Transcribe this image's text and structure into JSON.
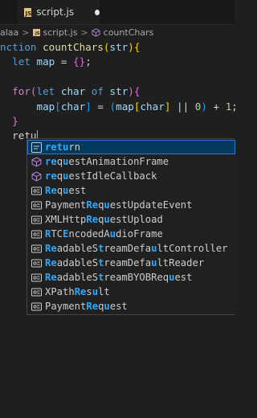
{
  "tab": {
    "name": "script.js",
    "badge": "JS"
  },
  "breadcrumb": {
    "folder": "alaa",
    "file": "script.js",
    "symbol": "countChars",
    "sep": ">"
  },
  "code": {
    "l1": {
      "kw": "nction",
      "sp1": " ",
      "fn": "countChars",
      "p_open": "(",
      "param": "str",
      "p_close": ")",
      "brace": "{"
    },
    "l2": {
      "indent": "  ",
      "kw": "let",
      "sp": " ",
      "var": "map",
      "rest1": " = ",
      "b1": "{",
      "b2": "}",
      "semi": ";"
    },
    "l4": {
      "indent": "  ",
      "kw": "for",
      "p1": "(",
      "kw2": "let",
      "sp": " ",
      "var1": "char",
      "kw3": " of ",
      "var2": "str",
      "p2": ")",
      "b": "{"
    },
    "l5": {
      "indent": "      ",
      "v1": "map",
      "k1": "[",
      "v2": "char",
      "k2": "]",
      "mid": " = ",
      "po": "(",
      "v3": "map",
      "k3": "[",
      "v4": "char",
      "k4": "]",
      "or": " || ",
      "num0": "0",
      "pc": ")",
      "plus": " + ",
      "num1": "1",
      "semi": ";"
    },
    "l6": {
      "indent": "  ",
      "b": "}"
    },
    "l8": {
      "indent": "  ",
      "typed": "retu"
    }
  },
  "suggestions": [
    {
      "kind": "keyword",
      "match": "retu",
      "rest": "rn"
    },
    {
      "kind": "method",
      "match": "requ",
      "rest": "estAnimationFrame",
      "pre": ""
    },
    {
      "kind": "method",
      "match": "requ",
      "rest": "estIdleCallback",
      "pre": ""
    },
    {
      "kind": "class",
      "pre": "Req",
      "parts": [
        "Re",
        "q",
        "u",
        "est"
      ]
    },
    {
      "kind": "class",
      "text": "PaymentRequestUpdateEvent"
    },
    {
      "kind": "class",
      "text": "XMLHttpRequestUpload"
    },
    {
      "kind": "class",
      "text": "RTCEncodedAudioFrame"
    },
    {
      "kind": "class",
      "text": "ReadableStreamDefaultController"
    },
    {
      "kind": "class",
      "text": "ReadableStreamDefaultReader"
    },
    {
      "kind": "class",
      "text": "ReadableStreamBYOBRequest"
    },
    {
      "kind": "class",
      "text": "XPathResult"
    },
    {
      "kind": "class",
      "text": "PaymentRequest"
    }
  ],
  "suggest_rows": [
    {
      "segments": [
        [
          "ret",
          true
        ],
        [
          "u",
          true
        ],
        [
          "rn",
          false
        ]
      ]
    },
    {
      "segments": [
        [
          "re",
          true
        ],
        [
          "q",
          false
        ],
        [
          "u",
          true
        ],
        [
          "estAnimationFrame",
          false
        ]
      ]
    },
    {
      "segments": [
        [
          "re",
          true
        ],
        [
          "q",
          false
        ],
        [
          "u",
          true
        ],
        [
          "estIdleCallback",
          false
        ]
      ]
    },
    {
      "segments": [
        [
          "Re",
          true
        ],
        [
          "q",
          false
        ],
        [
          "u",
          true
        ],
        [
          "est",
          false
        ]
      ]
    },
    {
      "segments": [
        [
          "Payment",
          false
        ],
        [
          "Re",
          true
        ],
        [
          "q",
          false
        ],
        [
          "u",
          true
        ],
        [
          "estUpdateEvent",
          false
        ]
      ]
    },
    {
      "segments": [
        [
          "XMLHttp",
          false
        ],
        [
          "Re",
          true
        ],
        [
          "q",
          false
        ],
        [
          "u",
          true
        ],
        [
          "estUpload",
          false
        ]
      ]
    },
    {
      "segments": [
        [
          "R",
          true
        ],
        [
          "TC",
          false
        ],
        [
          "E",
          true
        ],
        [
          "ncodedA",
          false
        ],
        [
          "u",
          true
        ],
        [
          "dioFrame",
          false
        ]
      ]
    },
    {
      "segments": [
        [
          "Re",
          true
        ],
        [
          "adableS",
          false
        ],
        [
          "t",
          true
        ],
        [
          "reamDefa",
          false
        ],
        [
          "u",
          true
        ],
        [
          "ltController",
          false
        ]
      ]
    },
    {
      "segments": [
        [
          "Re",
          true
        ],
        [
          "adableS",
          false
        ],
        [
          "t",
          true
        ],
        [
          "reamDefa",
          false
        ],
        [
          "u",
          true
        ],
        [
          "ltReader",
          false
        ]
      ]
    },
    {
      "segments": [
        [
          "Re",
          true
        ],
        [
          "adableS",
          false
        ],
        [
          "t",
          true
        ],
        [
          "reamBYOBReq",
          false
        ],
        [
          "u",
          true
        ],
        [
          "est",
          false
        ]
      ]
    },
    {
      "segments": [
        [
          "XPath",
          false
        ],
        [
          "Re",
          true
        ],
        [
          "s",
          false
        ],
        [
          "u",
          true
        ],
        [
          "lt",
          false
        ]
      ]
    },
    {
      "segments": [
        [
          "Payment",
          false
        ],
        [
          "Re",
          true
        ],
        [
          "q",
          false
        ],
        [
          "u",
          true
        ],
        [
          "est",
          false
        ]
      ]
    }
  ],
  "colors": {
    "accent": "#2aaaff",
    "selected_bg": "#04395e",
    "selected_border": "#2b79d0",
    "class_icon": "#75beff",
    "method_icon": "#b180d7"
  }
}
